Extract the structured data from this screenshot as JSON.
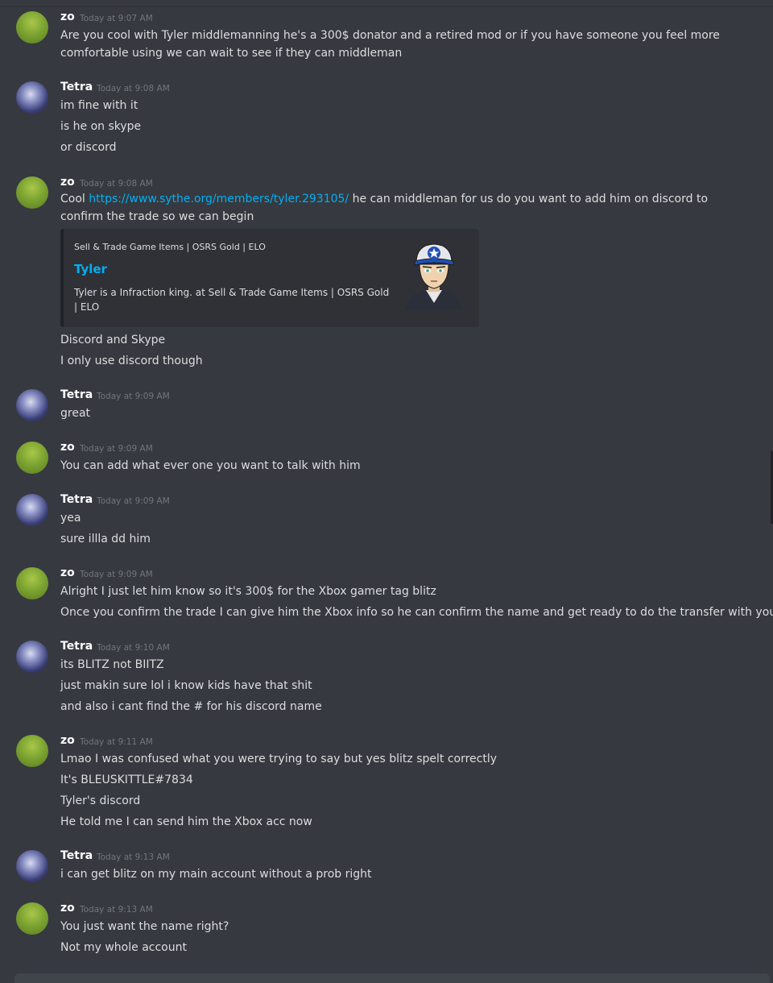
{
  "messages": [
    {
      "author": "zo",
      "timestamp": "Today at 9:07 AM",
      "lines": [
        "Are you cool with Tyler middlemanning he's a 300$ donator and a retired mod or if you have someone you feel more",
        "comfortable using we can wait to see if they can middleman"
      ]
    },
    {
      "author": "Tetra",
      "timestamp": "Today at 9:08 AM",
      "lines": [
        "im fine with it",
        "is he on skype",
        "or discord"
      ]
    },
    {
      "author": "zo",
      "timestamp": "Today at 9:08 AM",
      "lines": [
        "Cool",
        "https://www.sythe.org/members/tyler.293105/",
        "he can middleman for us do you want to add him on discord to",
        "confirm the trade so we can begin",
        "Discord and Skype",
        "I only use discord though"
      ]
    },
    {
      "author": "Tetra",
      "timestamp": "Today at 9:09 AM",
      "lines": [
        "great"
      ]
    },
    {
      "author": "zo",
      "timestamp": "Today at 9:09 AM",
      "lines": [
        "You can add what ever one you want to talk with him"
      ]
    },
    {
      "author": "Tetra",
      "timestamp": "Today at 9:09 AM",
      "lines": [
        "yea",
        "sure illla dd him"
      ]
    },
    {
      "author": "zo",
      "timestamp": "Today at 9:09 AM",
      "lines": [
        "Alright I just let him know so it's 300$ for the Xbox gamer tag blitz",
        "Once you confirm the trade I can give him the Xbox info so he can confirm the name and get ready to do the transfer with you"
      ]
    },
    {
      "author": "Tetra",
      "timestamp": "Today at 9:10 AM",
      "lines": [
        "its BLITZ not BIITZ",
        "just makin sure lol i know kids have that shit",
        "and also i cant find the # for his discord name"
      ]
    },
    {
      "author": "zo",
      "timestamp": "Today at 9:11 AM",
      "lines": [
        "Lmao I was confused what you were trying to say but yes blitz spelt correctly",
        "It's BLEUSKITTLE#7834",
        "Tyler's discord",
        "He told me I can send him the Xbox acc now"
      ]
    },
    {
      "author": "Tetra",
      "timestamp": "Today at 9:13 AM",
      "lines": [
        "i can get blitz on my main account without a prob right"
      ]
    },
    {
      "author": "zo",
      "timestamp": "Today at 9:13 AM",
      "lines": [
        "You just want the name right?",
        "Not my whole account"
      ]
    }
  ],
  "embed": {
    "provider": "Sell & Trade Game Items | OSRS Gold | ELO",
    "title": "Tyler",
    "description": "Tyler is a Infraction king. at Sell & Trade Game Items | OSRS Gold | ELO"
  },
  "colors": {
    "background": "#36393f",
    "link": "#00b0f4",
    "embed_bg": "#2f3136"
  }
}
